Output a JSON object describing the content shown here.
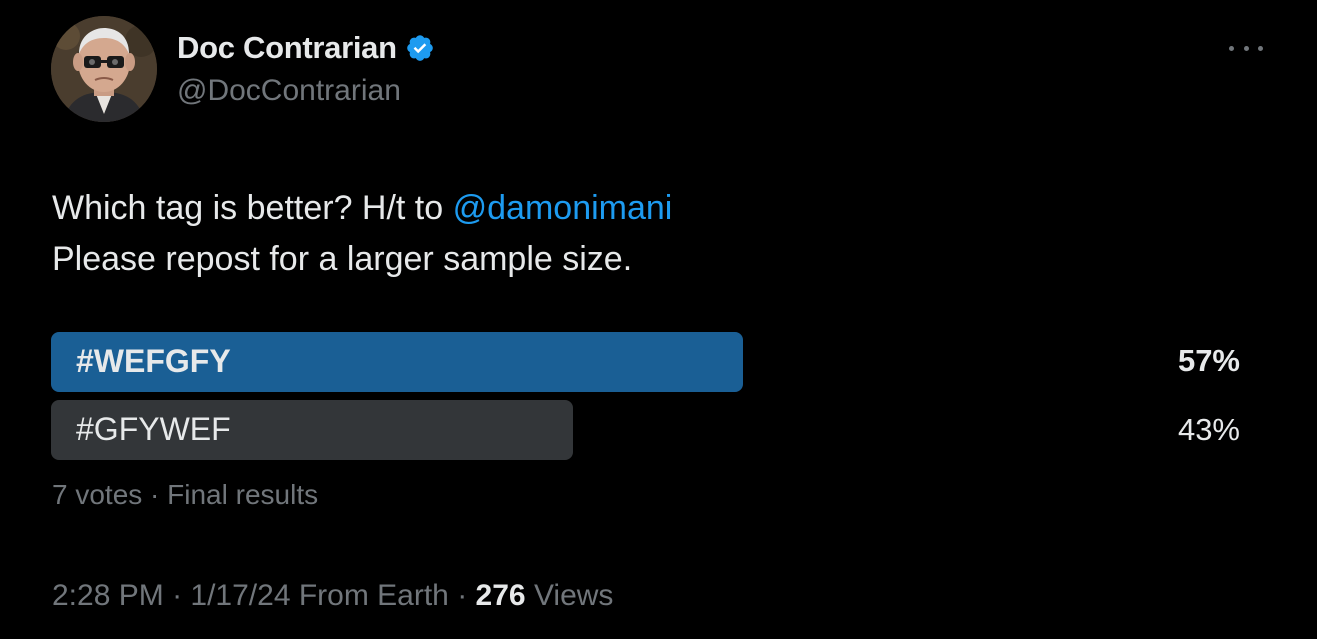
{
  "author": {
    "display_name": "Doc Contrarian",
    "handle": "@DocContrarian",
    "verified": true,
    "verified_color": "#1d9bf0"
  },
  "tweet": {
    "text_line1": "Which tag is better? H/t to ",
    "mention": "@damonimani",
    "text_line2": "Please repost for a larger sample size."
  },
  "poll": {
    "options": [
      {
        "label": "#WEFGFY",
        "percent": 57,
        "percent_label": "57%",
        "winner": true,
        "bar_color": "#1a5f95"
      },
      {
        "label": "#GFYWEF",
        "percent": 43,
        "percent_label": "43%",
        "winner": false,
        "bar_color": "#333639"
      }
    ],
    "meta": "7 votes · Final results"
  },
  "footer": {
    "time": "2:28 PM",
    "separator": " · ",
    "date": "1/17/24",
    "source": " From Earth",
    "separator2": " · ",
    "views_count": "276",
    "views_label": " Views"
  },
  "icons": {
    "more": "more-options-icon",
    "verified": "verified-badge-icon"
  },
  "colors": {
    "background": "#000000",
    "text_primary": "#e7e9ea",
    "text_secondary": "#71767b",
    "link": "#1d9bf0"
  }
}
